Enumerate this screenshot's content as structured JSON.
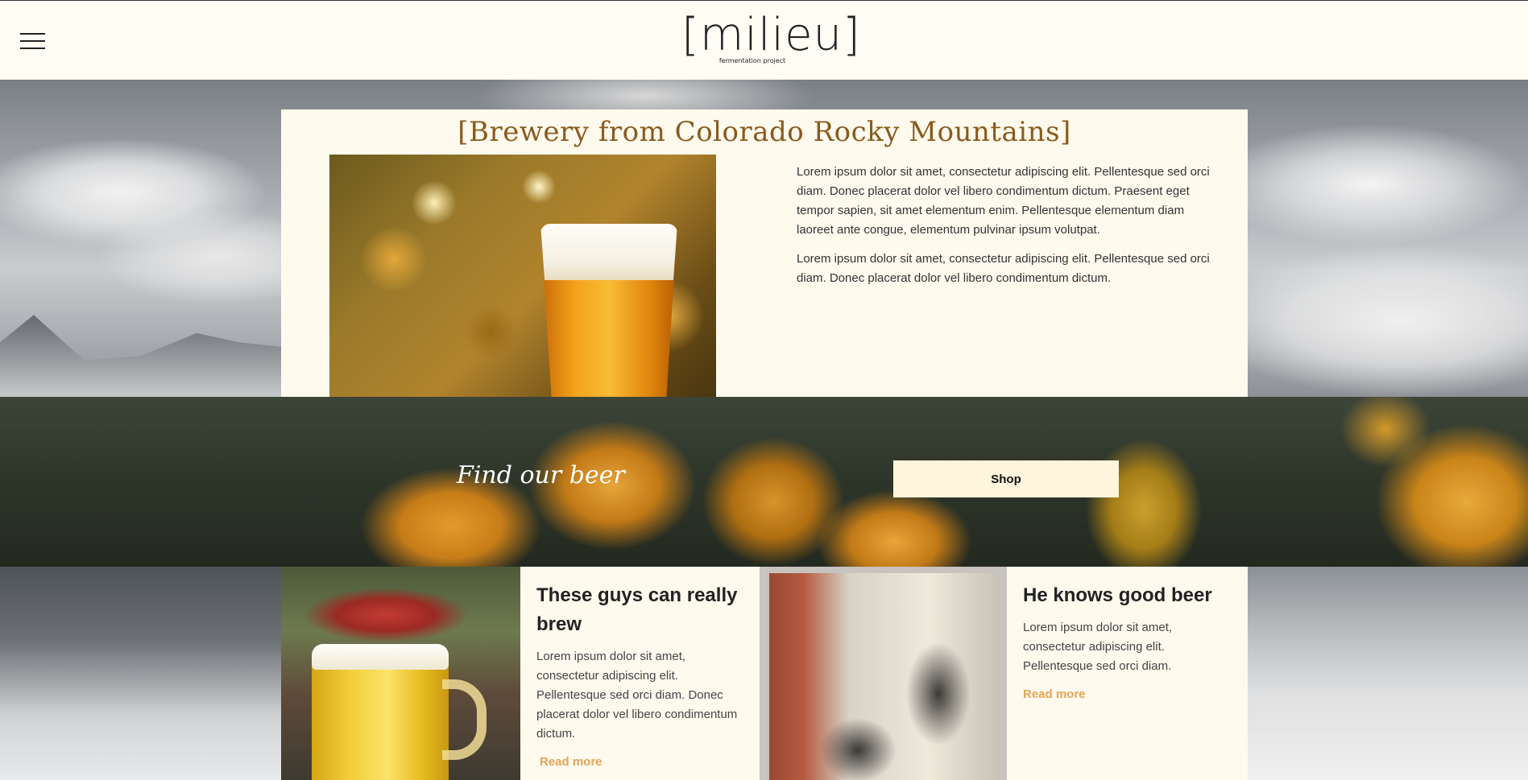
{
  "header": {
    "menu_icon": "hamburger-menu-icon",
    "logo_main": "[milieu]",
    "logo_sub": "fermentation project"
  },
  "intro": {
    "title": "[Brewery from Colorado Rocky Mountains]",
    "paragraphs": [
      "Lorem ipsum dolor sit amet, consectetur adipiscing elit. Pellentesque sed orci diam. Donec placerat dolor vel libero condimentum dictum. Praesent eget tempor sapien, sit amet elementum enim. Pellentesque elementum diam laoreet ante congue, elementum pulvinar ipsum volutpat.",
      "Lorem ipsum dolor sit amet, consectetur adipiscing elit. Pellentesque sed orci diam. Donec placerat dolor vel libero condimentum dictum."
    ]
  },
  "band": {
    "tagline": "Find our beer",
    "shop_label": "Shop"
  },
  "tiles": [
    {
      "heading": "These guys can really brew",
      "body": "Lorem ipsum dolor sit amet, consectetur adipiscing elit. Pellentesque sed orci diam. Donec placerat dolor vel libero condimentum dictum.",
      "link": "Read more"
    },
    {
      "heading": "He knows good beer",
      "body": "Lorem ipsum dolor sit amet, consectetur adipiscing elit. Pellentesque sed orci diam.",
      "link": "Read more"
    }
  ],
  "colors": {
    "page_bg": "#fffcf2",
    "card_bg": "#fffaee",
    "title_brown": "#8a5a1c",
    "link_orange": "#e4a458",
    "button_bg": "#fff4dc"
  }
}
